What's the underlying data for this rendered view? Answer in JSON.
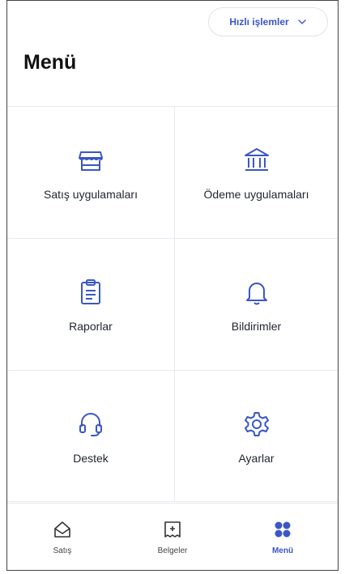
{
  "header": {
    "quick_actions_label": "Hızlı işlemler",
    "title": "Menü"
  },
  "menu_items": [
    {
      "label": "Satış uygulamaları",
      "icon": "store-icon"
    },
    {
      "label": "Ödeme uygulamaları",
      "icon": "bank-icon"
    },
    {
      "label": "Raporlar",
      "icon": "clipboard-icon"
    },
    {
      "label": "Bildirimler",
      "icon": "bell-icon"
    },
    {
      "label": "Destek",
      "icon": "headset-icon"
    },
    {
      "label": "Ayarlar",
      "icon": "gear-icon"
    }
  ],
  "tabbar": [
    {
      "label": "Satış",
      "icon": "sales-icon",
      "active": false
    },
    {
      "label": "Belgeler",
      "icon": "documents-icon",
      "active": false
    },
    {
      "label": "Menü",
      "icon": "grid-menu-icon",
      "active": true
    }
  ],
  "colors": {
    "accent": "#3a56c8",
    "border": "#e7e9ef",
    "text": "#1f2430"
  }
}
